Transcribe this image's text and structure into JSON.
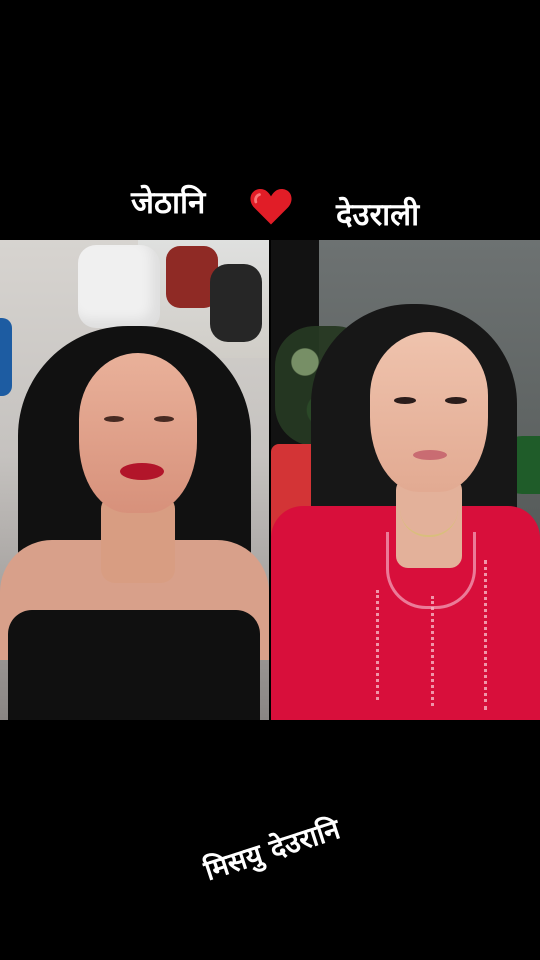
{
  "captions": {
    "top_left": "जेठानि",
    "top_right": "देउराली",
    "bottom": "मिसयु देउरानि"
  },
  "icons": {
    "heart": "heart-icon"
  },
  "colors": {
    "background": "#000000",
    "heart": "#e11d27",
    "left_top": "#101010",
    "right_kurta": "#d80f3b"
  }
}
